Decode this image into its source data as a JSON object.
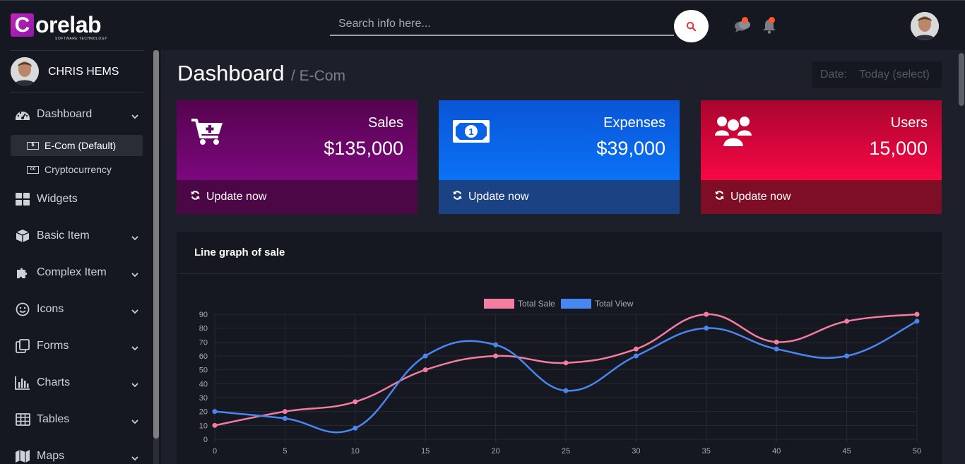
{
  "brand": {
    "name": "orelab",
    "mark": "C",
    "tagline": "SOFTWARE TECHNOLOGY"
  },
  "search": {
    "placeholder": "Search info here..."
  },
  "user": {
    "name": "CHRIS HEMS"
  },
  "sidebar": {
    "items": [
      {
        "label": "Dashboard",
        "icon": "dashboard-icon",
        "has_children": true
      },
      {
        "label": "Widgets",
        "icon": "widgets-icon",
        "has_children": false
      },
      {
        "label": "Basic Item",
        "icon": "cube-icon",
        "has_children": true
      },
      {
        "label": "Complex Item",
        "icon": "puzzle-icon",
        "has_children": true
      },
      {
        "label": "Icons",
        "icon": "smile-icon",
        "has_children": true
      },
      {
        "label": "Forms",
        "icon": "forms-icon",
        "has_children": true
      },
      {
        "label": "Charts",
        "icon": "bar-chart-icon",
        "has_children": true
      },
      {
        "label": "Tables",
        "icon": "table-icon",
        "has_children": true
      },
      {
        "label": "Maps",
        "icon": "map-icon",
        "has_children": true
      }
    ],
    "sub_items": [
      {
        "label": "E-Com (Default)",
        "icon": "money-icon",
        "active": true
      },
      {
        "label": "Cryptocurrency",
        "icon": "cc-icon",
        "active": false
      }
    ]
  },
  "header": {
    "title": "Dashboard",
    "subtitle": "/ E-Com",
    "date_label": "Date:",
    "date_value": "Today (select)"
  },
  "cards": [
    {
      "label": "Sales",
      "value": "$135,000",
      "action": "Update now",
      "icon": "cart-plus-icon",
      "color": "#7c087d"
    },
    {
      "label": "Expenses",
      "value": "$39,000",
      "action": "Update now",
      "icon": "money-bill-icon",
      "color": "#0a72f5"
    },
    {
      "label": "Users",
      "value": "15,000",
      "action": "Update now",
      "icon": "users-icon",
      "color": "#f90746"
    }
  ],
  "chart_panel": {
    "title": "Line graph of sale"
  },
  "chart_data": {
    "type": "line",
    "x": [
      0,
      5,
      10,
      15,
      20,
      25,
      30,
      35,
      40,
      45,
      50
    ],
    "series": [
      {
        "name": "Total Sale",
        "color": "#f47da0",
        "values": [
          10,
          20,
          27,
          50,
          60,
          55,
          65,
          90,
          70,
          85,
          90
        ]
      },
      {
        "name": "Total View",
        "color": "#4a86f0",
        "values": [
          20,
          15,
          8,
          60,
          68,
          35,
          60,
          80,
          65,
          60,
          85
        ]
      }
    ],
    "ylim": [
      0,
      90
    ],
    "yticks": [
      0,
      10,
      20,
      30,
      40,
      50,
      60,
      70,
      80,
      90
    ],
    "grid": true,
    "legend": "top-center"
  }
}
